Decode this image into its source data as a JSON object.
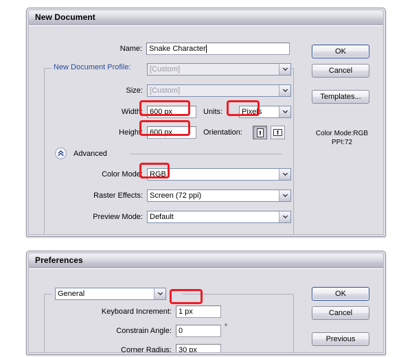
{
  "new_document": {
    "title": "New Document",
    "profile_group_label": "New Document Profile:",
    "fields": {
      "name_label": "Name:",
      "name_value": "Snake Character",
      "profile_value": "[Custom]",
      "size_label": "Size:",
      "size_value": "[Custom]",
      "width_label": "Width:",
      "width_value": "600 px",
      "height_label": "Height:",
      "height_value": "600 px",
      "units_label": "Units:",
      "units_value": "Pixels",
      "orientation_label": "Orientation:",
      "advanced_label": "Advanced",
      "color_mode_label": "Color Mode:",
      "color_mode_value": "RGB",
      "raster_effects_label": "Raster Effects:",
      "raster_effects_value": "Screen (72 ppi)",
      "preview_mode_label": "Preview Mode:",
      "preview_mode_value": "Default"
    },
    "buttons": {
      "ok": "OK",
      "cancel": "Cancel",
      "templates": "Templates..."
    },
    "info": {
      "color_mode": "Color Mode:RGB",
      "ppi": "PPI:72"
    },
    "icons": {
      "portrait": "portrait-orientation-icon",
      "landscape": "landscape-orientation-icon",
      "disclosure": "chevron-double-up-icon"
    }
  },
  "preferences": {
    "title": "Preferences",
    "category_value": "General",
    "fields": {
      "keyboard_increment_label": "Keyboard Increment:",
      "keyboard_increment_value": "1 px",
      "constrain_angle_label": "Constrain Angle:",
      "constrain_angle_value": "0",
      "constrain_angle_unit": "°",
      "corner_radius_label": "Corner Radius:",
      "corner_radius_value": "30 px"
    },
    "buttons": {
      "ok": "OK",
      "cancel": "Cancel",
      "previous": "Previous"
    }
  },
  "annotations": {
    "highlight_color": "#ee1c24",
    "highlighted": [
      "width_value",
      "height_value",
      "units_value",
      "color_mode_value",
      "keyboard_increment_value"
    ]
  }
}
